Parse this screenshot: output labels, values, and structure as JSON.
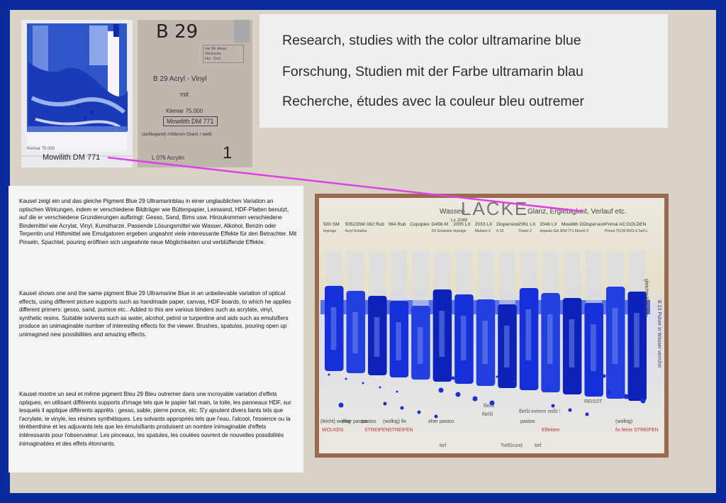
{
  "headline": {
    "en": "Research, studies with the color ultramarine blue",
    "de": "Forschung, Studien mit der Farbe ultramarin blau",
    "fr": "Recherche, études avec la couleur bleu outremer"
  },
  "texts": {
    "de": "Kausel zeigt ein und das gleiche Pigment Blue 29 Ultramarinblau in einer unglaublichen Variation an optischen Wirkungen, indem er verschiedene Bildträger wie Büttenpapier, Leinwand, HDF-Platten benutzt, auf die er verschiedene Grundierungen aufbringt: Gesso, Sand, Bims usw.  Hinzukommen verschiedene Bindemittel wie Acrylat, Vinyl, Kunstharze. Passende Lösungsmittel wie Wasser, Alkohol, Benzin oder Terpentin und Hilfsmittel wie Emulgatoren ergeben ungeahnt viele interessante Effekte für den Betrachter.  Mit  Pinseln, Spachtel, pouring eröffnen sich ungeahnte neue Möglichkeiten und verblüffende Effekte.",
    "en": "Kausel shows one and the same pigment Blue 29 Ultramarine Blue in an unbelievable variation of optical effects, using different picture supports such as handmade paper, canvas, HDF boards, to which he applies different primers: gesso, sand, pumice etc..  Added to this are various binders such as acrylate, vinyl, synthetic resins. Suitable solvents such as water, alcohol, petrol or turpentine and aids such as emulsifiers produce an unimaginable number of interesting effects for the viewer. Brushes, spatulas, pouring open up unimagined new possibilities and amazing effects.",
    "fr": "Kausel montre un seul et même pigment Bleu 29 Bleu outremer dans une incroyable variation d'effets optiques, en utilisant différents supports d'image tels que le papier fait main, la toile, les panneaux HDF, sur lesquels il applique différents apprêts : gesso, sable, pierre ponce, etc.  S'y ajoutent divers liants tels que l'acrylate, le vinyle, les résines synthétiques. Les solvants appropriés tels que l'eau, l'alcool, l'essence ou la térébenthine et les adjuvants tels que les émulsifiants produisent un nombre inimaginable d'effets intéressants pour l'observateur. Les pinceaux, les spatules, les coulées ouvrent de nouvelles possibilités inimaginables et des effets étonnants."
  },
  "photo1": {
    "caption": "Mowilith  DM 771",
    "small_note": "Klemar 75.000"
  },
  "photo2": {
    "code": "B 29",
    "line1": "B 29  Acryl - Vinyl",
    "line2": "mit",
    "line3": "Klemar 75.000",
    "line4": "Mowilith DM 771",
    "line5": "(aufliegend) mittleren Glanz / weiß",
    "line6": "L 076  Acrylm",
    "number": "1",
    "corner_note": "nur für diese Versuche",
    "corner_note2": "Ha - Sort"
  },
  "board": {
    "title_prefix": "Wasser-",
    "title_big": "LACKE",
    "title_suffix": "Glanz, Ergiebigkeit, Verlauf etc.",
    "extra_label": "Lx 2048",
    "labels": [
      "500 SM",
      "50523SM",
      "062 Rub",
      "064 Rub",
      "Copoplex",
      "D498-M",
      "2005 LX",
      "2033 LX",
      "Dispersion",
      "2061 LX",
      "2046 LX",
      "Mowilith D",
      "Dispersion",
      "Primal AC35",
      "GOLDEN"
    ],
    "sublabels": [
      "Impräge",
      "Acryl Schuhlack",
      "",
      "",
      "",
      "DX Emulsion",
      "Imprägn",
      "Medium 3",
      "K 52",
      "Tönplx 2",
      "Impasto Gel 2",
      "DM 771 Klemar 75.000",
      "K 9",
      "Primal 75100",
      "0001-6 Self Leveling Clear"
    ],
    "side_text": "gleichmäßig Blau",
    "side_text2": "B 23 Pulver in Wasser verrührt",
    "flow_label": "fließt",
    "bottom": [
      "(leicht) wolkig",
      "eher pastos",
      "pastos",
      "(wolkig) fix",
      "eher pastos",
      "pastos",
      "(wolkig)"
    ],
    "bottom2": [
      "WOLKEN",
      "STREIFEN",
      "STREIFEN",
      "Effekten",
      "fix feine STREIFEN"
    ],
    "notes": [
      "fließt",
      "fließt extrem reißt !",
      "REISST",
      "tief",
      "TiefGrund",
      "tief"
    ]
  },
  "colors": {
    "frame": "#0b2a9c",
    "panel": "#d9d2c6",
    "accent_line": "#e040e8",
    "ultramarine": "#1a2fd6"
  }
}
